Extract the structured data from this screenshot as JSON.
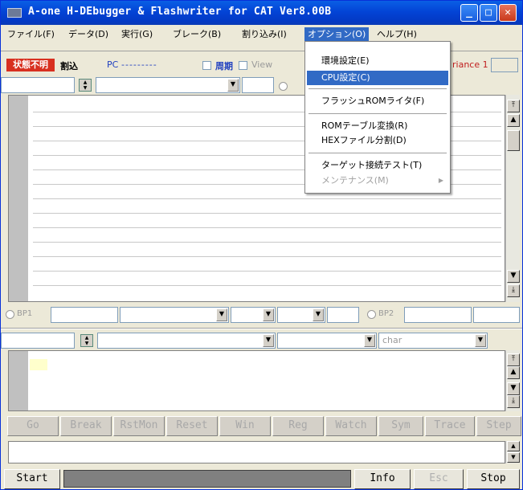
{
  "window": {
    "title": "A-one H-DEbugger & Flashwriter for CAT Ver8.00B",
    "controls": {
      "minimize": "_",
      "maximize": "□",
      "close": "✕"
    }
  },
  "menubar": [
    {
      "label": "ファイル(F)"
    },
    {
      "label": "データ(D)"
    },
    {
      "label": "実行(G)"
    },
    {
      "label": "ブレーク(B)"
    },
    {
      "label": "割り込み(I)"
    },
    {
      "label": "オプション(O)",
      "active": true
    },
    {
      "label": "ヘルプ(H)"
    }
  ],
  "options_menu": {
    "items": [
      {
        "label": "環境設定(E)",
        "state": "normal"
      },
      {
        "label": "CPU設定(C)",
        "state": "highlighted"
      },
      {
        "label": "フラッシュROMライタ(F)",
        "state": "normal"
      },
      {
        "label": "ROMテーブル変換(R)",
        "state": "normal"
      },
      {
        "label": "HEXファイル分割(D)",
        "state": "normal"
      },
      {
        "label": "ターゲット接続テスト(T)",
        "state": "normal"
      },
      {
        "label": "メンテナンス(M)",
        "state": "disabled",
        "submenu": true
      }
    ],
    "submenu_arrow": "▶"
  },
  "status_row": {
    "run_state": "状態不明",
    "interrupt_label": "割込",
    "pc_label": "PC",
    "pc_value": "---------",
    "period_label": "周期",
    "view_label": "View",
    "variance_label": "riance 1"
  },
  "bp_row": {
    "bp1_label": "BP1",
    "bp2_label": "BP2"
  },
  "pane2": {
    "type_value": "char"
  },
  "toolbar_buttons": [
    {
      "label": "Go"
    },
    {
      "label": "Break"
    },
    {
      "label": "RstMon"
    },
    {
      "label": "Reset"
    },
    {
      "label": "Win"
    },
    {
      "label": "Reg"
    },
    {
      "label": "Watch"
    },
    {
      "label": "Sym"
    },
    {
      "label": "Trace"
    },
    {
      "label": "Step"
    }
  ],
  "bottom": {
    "start_label": "Start",
    "info_label": "Info",
    "esc_label": "Esc",
    "stop_label": "Stop"
  },
  "colors": {
    "title_bar": "#0344d6",
    "menu_highlight": "#316ac5",
    "state_badge": "#d83020",
    "disabled_text": "#a8a8a8"
  }
}
